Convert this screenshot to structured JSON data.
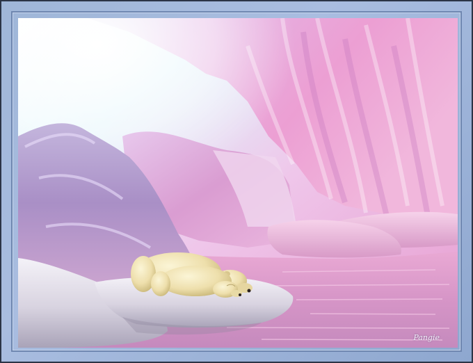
{
  "artwork": {
    "signature": "Pangie",
    "colors": {
      "frame": "#a9bde0",
      "frame_dark": "#2b3446",
      "ice_pink": "#e6a9d6",
      "ice_lavender": "#b79bd0",
      "ice_white": "#f4f2f8",
      "water": "#d79cc8",
      "bear_fur": "#efe4b6",
      "rock_gray": "#d7d4de"
    },
    "subjects": [
      "polar-bear-mother",
      "polar-bear-cub"
    ]
  }
}
